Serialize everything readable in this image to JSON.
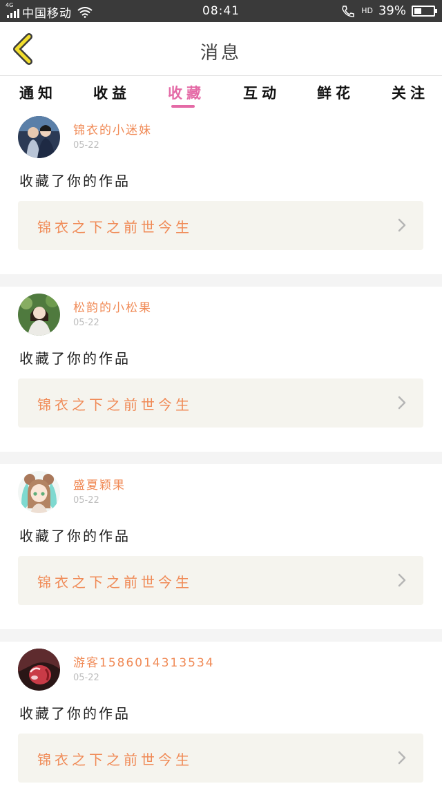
{
  "status_bar": {
    "network_type": "4G",
    "carrier": "中国移动",
    "time": "08:41",
    "hd_label": "HD",
    "battery_percent": "39%",
    "battery_level": 0.39
  },
  "header": {
    "title": "消息"
  },
  "tabs": [
    {
      "label": "通知",
      "active": false
    },
    {
      "label": "收益",
      "active": false
    },
    {
      "label": "收藏",
      "active": true
    },
    {
      "label": "互动",
      "active": false
    },
    {
      "label": "鲜花",
      "active": false
    },
    {
      "label": "关注",
      "active": false
    }
  ],
  "colors": {
    "accent": "#e46aa6",
    "username": "#f08a56",
    "card_bg": "#f5f4ee"
  },
  "messages": [
    {
      "username": "锦衣的小迷妹",
      "date": "05-22",
      "action": "收藏了你的作品",
      "work_title": "锦衣之下之前世今生"
    },
    {
      "username": "松韵的小松果",
      "date": "05-22",
      "action": "收藏了你的作品",
      "work_title": "锦衣之下之前世今生"
    },
    {
      "username": "盛夏颖果",
      "date": "05-22",
      "action": "收藏了你的作品",
      "work_title": "锦衣之下之前世今生"
    },
    {
      "username": "游客1586014313534",
      "date": "05-22",
      "action": "收藏了你的作品",
      "work_title": "锦衣之下之前世今生"
    }
  ]
}
